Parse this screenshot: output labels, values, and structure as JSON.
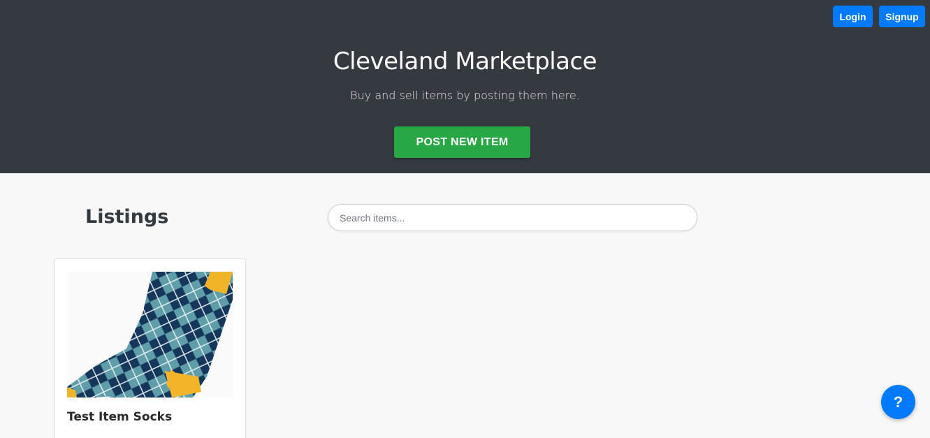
{
  "header": {
    "login_label": "Login",
    "signup_label": "Signup",
    "title": "Cleveland Marketplace",
    "subtitle": "Buy and sell items by posting them here.",
    "post_button_label": "POST NEW ITEM"
  },
  "main": {
    "heading": "Listings",
    "search": {
      "placeholder": "Search items...",
      "value": ""
    },
    "listings": [
      {
        "title": "Test Item Socks",
        "image": "argyle-socks-image"
      }
    ]
  },
  "help_button": {
    "label": "?",
    "icon": "question-mark-icon"
  },
  "colors": {
    "hero_bg": "#343a40",
    "primary": "#007bff",
    "success": "#28a745",
    "page_bg": "#f8f8f8"
  }
}
